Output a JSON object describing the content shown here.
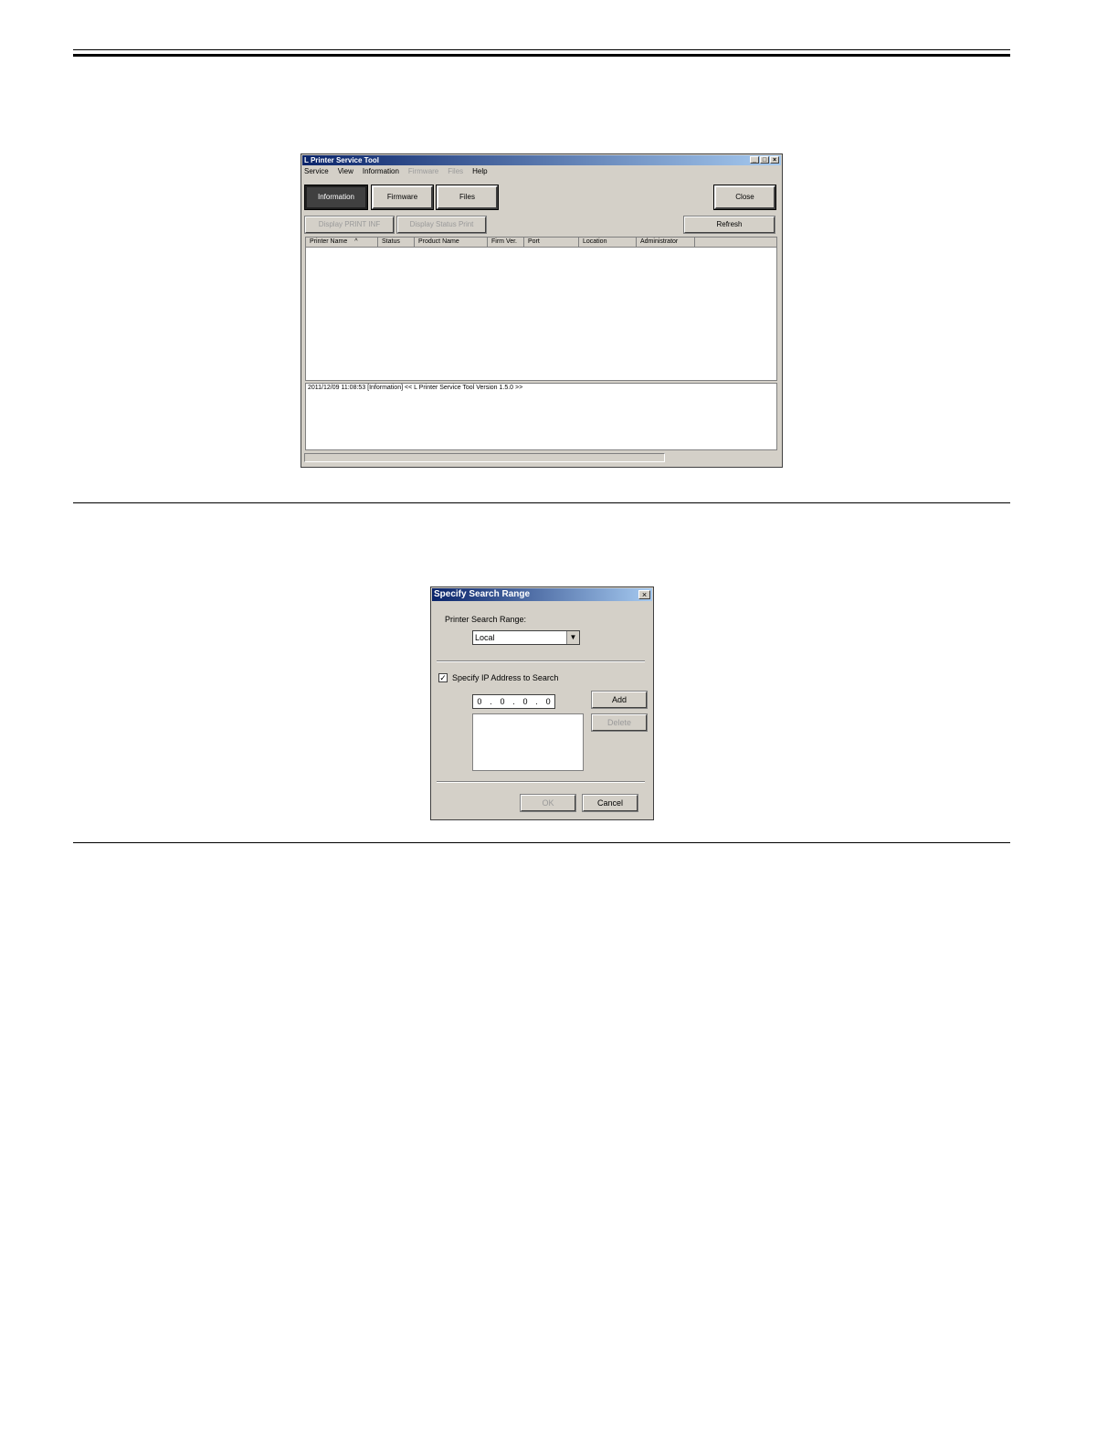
{
  "main_window": {
    "title": "L Printer Service Tool",
    "window_controls": [
      "_",
      "□",
      "×"
    ],
    "menu": [
      "Service",
      "View",
      "Information",
      "Firmware",
      "Files",
      "Help"
    ],
    "menu_disabled": [
      false,
      false,
      false,
      true,
      true,
      false
    ],
    "tabs": [
      "Information",
      "Firmware",
      "Files"
    ],
    "active_tab": "Information",
    "close_label": "Close",
    "display_print_inf_label": "Display PRINT INF",
    "display_status_print_label": "Display Status Print",
    "refresh_label": "Refresh",
    "columns": [
      "Printer Name",
      "Status",
      "Product Name",
      "Firm Ver.",
      "Port",
      "Location",
      "Administrator"
    ],
    "sort_indicator": "^",
    "log_line": "2011/12/09 11:08:53 [Information]  << L Printer Service Tool  Version 1.5.0 >>"
  },
  "dialog": {
    "title": "Specify Search Range",
    "close_glyph": "×",
    "search_range_label": "Printer Search Range:",
    "search_range_value": "Local",
    "specify_ip_label": "Specify IP Address to Search",
    "specify_ip_checked": true,
    "ip_octets": [
      "0",
      "0",
      "0",
      "0"
    ],
    "add_label": "Add",
    "delete_label": "Delete",
    "ok_label": "OK",
    "cancel_label": "Cancel"
  }
}
